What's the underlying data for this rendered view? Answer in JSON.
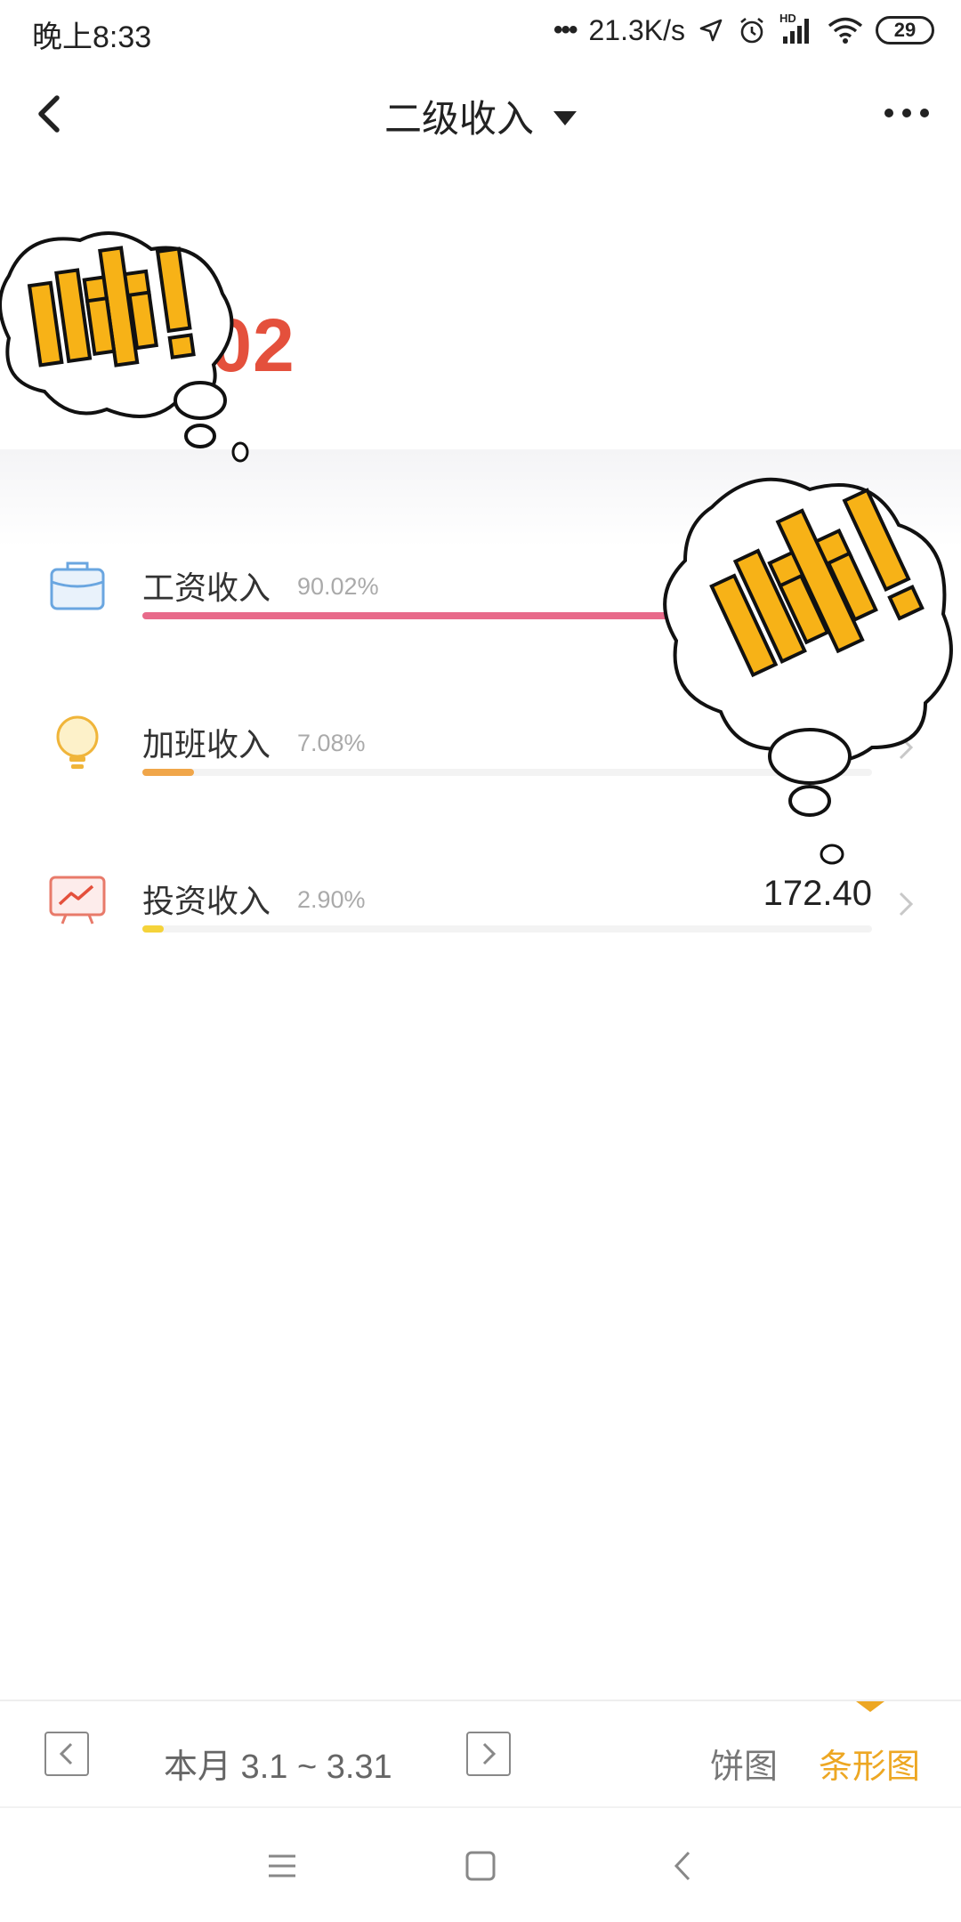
{
  "status_bar": {
    "time": "晚上8:33",
    "network_speed": "21.3K/s",
    "battery": "29",
    "hd_label": "HD"
  },
  "nav": {
    "title": "二级收入"
  },
  "summary": {
    "total_visible": ".02"
  },
  "categories": [
    {
      "label": "工资收入",
      "percent": "90.02%",
      "amount": "",
      "fill_percent": 90.02,
      "color": "#e86a8a",
      "icon": "briefcase-icon"
    },
    {
      "label": "加班收入",
      "percent": "7.08%",
      "amount": "",
      "fill_percent": 7.08,
      "color": "#f0a64a",
      "icon": "lightbulb-icon"
    },
    {
      "label": "投资收入",
      "percent": "2.90%",
      "amount": "172.40",
      "fill_percent": 2.9,
      "color": "#f5d33a",
      "icon": "trend-monitor-icon"
    }
  ],
  "stickers": [
    {
      "text": "帅!",
      "name": "sticker-shuai-top-left"
    },
    {
      "text": "帅!",
      "name": "sticker-shuai-right"
    }
  ],
  "toolbar": {
    "period": "本月 3.1 ~ 3.31",
    "pie_label": "饼图",
    "bar_label": "条形图",
    "active_color": "#eda723"
  }
}
